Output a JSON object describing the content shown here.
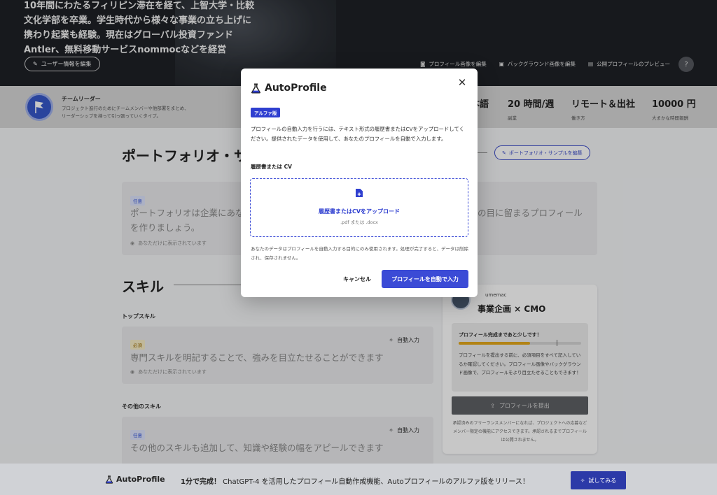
{
  "hero": {
    "lines": [
      "10年間にわたるフィリピン滞在を経て、上智大学・比較",
      "文化学部を卒業。学生時代から様々な事業の立ち上げに",
      "携わり起業も経験。現在はグローバル投資ファンド",
      "Antler、無料移動サービスnommocなどを経営"
    ],
    "edit_user_label": "ユーザー情報を編集",
    "actions": {
      "edit_profile_image": "プロフィール画像を編集",
      "edit_background": "バックグラウンド画像を編集",
      "preview_public": "公開プロフィールのプレビュー"
    },
    "help_label": "?"
  },
  "infobar": {
    "role_title": "チームリーダー",
    "role_desc_1": "プロジェクト進行のためにチームメンバーや他部署をまとめ、",
    "role_desc_2": "リーダーシップを持って引っ張っていくタイプ。",
    "stats": [
      {
        "value": "本語",
        "label": ""
      },
      {
        "value": "20 時間/週",
        "label": "副業"
      },
      {
        "value": "リモート＆出社",
        "label": "働き方"
      },
      {
        "value": "10000 円",
        "label": "大まかな時間報酬"
      }
    ]
  },
  "portfolio": {
    "heading": "ポートフォリオ・サ",
    "edit_button": "ポートフォリオ・サンプルを編集",
    "tag": "任意",
    "text_left_1": "ポートフォリオは企業にあな",
    "text_left_2": "を作りましょう。",
    "text_right": "の目に留まるプロフィール",
    "visibility": "あなただけに表示されています"
  },
  "skills": {
    "heading": "スキル",
    "top_title": "トップスキル",
    "top_tag": "必須",
    "autofill": "自動入力",
    "top_text": "専門スキルを明記することで、強みを目立たせることができます",
    "visibility": "あなただけに表示されています",
    "other_title": "その他のスキル",
    "other_tag": "任意",
    "other_text": "その他のスキルも追加して、知識や経験の幅をアピールできます"
  },
  "panel": {
    "username": "umemac",
    "title": "事業企画 × CMO",
    "progress_title": "プロフィール完成まであと少しです！",
    "progress_fraction": 0.58,
    "progress_desc": "プロフィールを提出する前に、必須項目をすべて記入しているか確認してください。プロフィール画像やバックグラウンド画像で、プロフィールをより目立たせることもできます！",
    "submit_label": "プロフィールを提出",
    "note": "承認済みのフリーランスメンバーになれば、プロジェクトへの応募などメンバー限定の機能にアクセスできます。承認されるまでプロフィールは公開されません。"
  },
  "bottom": {
    "logo": "AutoProfile",
    "text_bold": "1分で完成！",
    "text_rest": " ChatGPT-4 を活用したプロフィール自動作成機能、Autoプロフィールのアルファ版をリリース！",
    "try_label": "試してみる"
  },
  "modal": {
    "logo": "AutoProfile",
    "close": "✕",
    "alpha_tag": "アルファ版",
    "description": "プロフィールの自動入力を行うには、テキスト形式の履歴書またはCVをアップロードしてください。提供されたデータを使用して、あなたのプロフィールを自動で入力します。",
    "label": "履歴書または CV",
    "upload_title": "履歴書またはCVをアップロード",
    "upload_formats": ".pdf または .docx",
    "note": "あなたのデータはプロフィールを自動入力する目的にのみ使用されます。処理が完了すると、データは削除され、保存されません。",
    "cancel": "キャンセル",
    "submit": "プロフィールを自動で入力"
  },
  "colors": {
    "accent": "#3b4bd6",
    "progress": "#e5a81c"
  }
}
